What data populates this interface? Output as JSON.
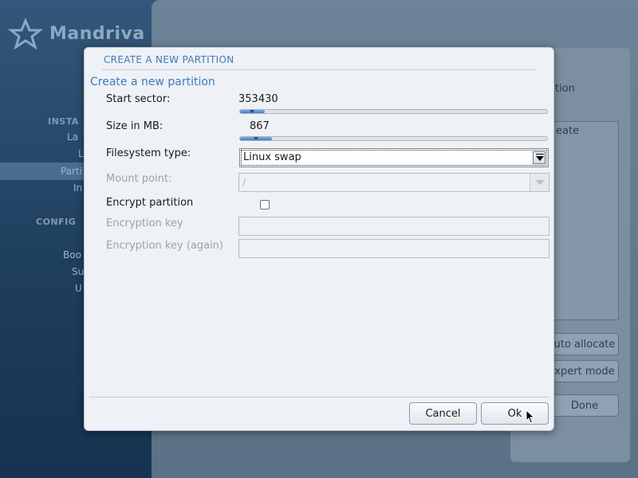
{
  "background": {
    "logo_text": "Mandriva",
    "nav_heading_install": "INSTA",
    "nav_heading_config": "CONFIG",
    "nav_items": [
      "La",
      "L",
      "Parti",
      "In",
      "Boo",
      "Su",
      "U"
    ],
    "right_labels": [
      "tion",
      "eate"
    ],
    "auto_allocate": "uto allocate",
    "expert_mode": "xpert mode",
    "done": "Done"
  },
  "dialog": {
    "title": "CREATE A NEW PARTITION",
    "heading": "Create a new partition",
    "start_sector": {
      "label": "Start sector:",
      "value": "353430",
      "fill": 0.08
    },
    "size_mb": {
      "label": "Size in MB:",
      "value": "867",
      "fill": 0.105
    },
    "filesystem": {
      "label": "Filesystem type:",
      "value": "Linux swap"
    },
    "mount_point": {
      "label": "Mount point:",
      "value": "/"
    },
    "encrypt": {
      "label": "Encrypt partition",
      "checked": false
    },
    "encryption_key": {
      "label": "Encryption key",
      "value": ""
    },
    "encryption_key_again": {
      "label": "Encryption key (again)",
      "value": ""
    },
    "cancel_label": "Cancel",
    "ok_label": "Ok"
  }
}
